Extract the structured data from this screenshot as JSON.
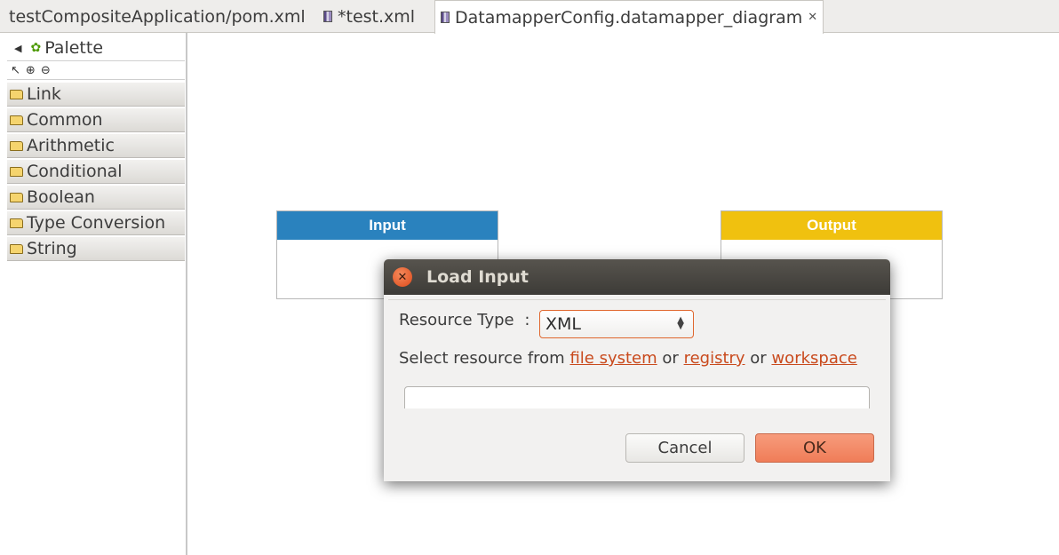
{
  "tabs": [
    {
      "label": "testCompositeApplication/pom.xml"
    },
    {
      "label": "*test.xml"
    },
    {
      "label": "DatamapperConfig.datamapper_diagram"
    }
  ],
  "palette": {
    "title": "Palette",
    "drawers": [
      "Link",
      "Common",
      "Arithmetic",
      "Conditional",
      "Boolean",
      "Type Conversion",
      "String"
    ]
  },
  "canvas": {
    "input_title": "Input",
    "output_title": "Output"
  },
  "colors": {
    "input_header": "#2a82be",
    "output_header": "#f0c10f",
    "accent": "#e0672e"
  },
  "dialog": {
    "title": "Load Input",
    "resource_type_label": "Resource Type",
    "resource_type_colon": ":",
    "resource_type_value": "XML",
    "select_prefix": "Select resource from",
    "link_file_system": "file system",
    "or1": "or",
    "link_registry": "registry",
    "or2": "or",
    "link_workspace": "workspace",
    "path_value": "",
    "cancel_label": "Cancel",
    "ok_label": "OK"
  }
}
